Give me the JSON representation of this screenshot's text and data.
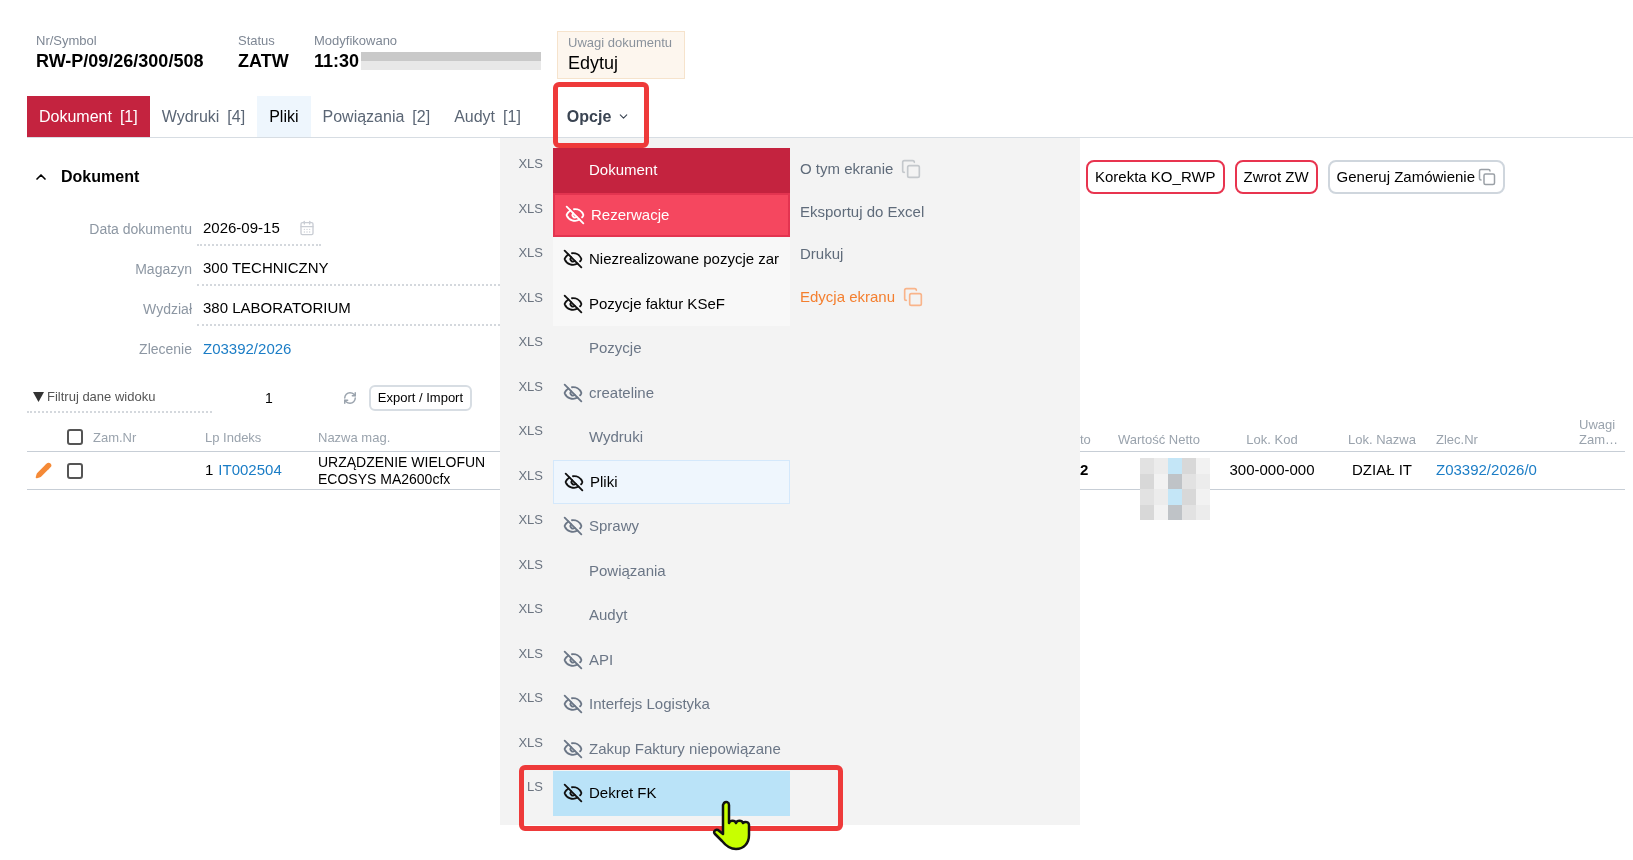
{
  "header": {
    "fields": [
      {
        "label": "Nr/Symbol",
        "value": "RW-P/09/26/300/508"
      },
      {
        "label": "Status",
        "value": "ZATW"
      },
      {
        "label": "Modyfikowano",
        "value": "11:30",
        "redacted": true
      }
    ],
    "notes": {
      "label": "Uwagi dokumentu",
      "value": "Edytuj"
    }
  },
  "tabs": [
    {
      "label": "Dokument",
      "count": "[1]",
      "kind": "tab",
      "selected": true
    },
    {
      "label": "Wydruki",
      "count": "[4]",
      "kind": "tab",
      "selected": false,
      "hovered": false
    },
    {
      "label": "Pliki",
      "kind": "tab",
      "selected": false,
      "hovered": true
    },
    {
      "label": "Powiązania",
      "count": "[2]",
      "kind": "tab",
      "selected": false,
      "hovered": false
    },
    {
      "label": "Audyt",
      "count": "[1]",
      "kind": "tab",
      "selected": false,
      "hovered": false
    },
    {
      "label": "Opcje",
      "kind": "menu",
      "selected": false,
      "hovered": false
    }
  ],
  "section": {
    "title": "Dokument",
    "expanded": true
  },
  "form": [
    {
      "label": "Data dokumentu",
      "value": "2026-09-15",
      "kind": "date"
    },
    {
      "label": "Magazyn",
      "value": "300 TECHNICZNY",
      "kind": "text"
    },
    {
      "label": "Wydział",
      "value": "380 LABORATORIUM",
      "kind": "text"
    },
    {
      "label": "Zlecenie",
      "value": "Z03392/2026",
      "kind": "link"
    }
  ],
  "actions": [
    {
      "label": "Korekta KO_RWP",
      "kind": "danger"
    },
    {
      "label": "Zwrot ZW",
      "kind": "danger"
    },
    {
      "label": "Generuj Zamówienie",
      "kind": "copy"
    }
  ],
  "filter": {
    "label": "Filtruj dane widoku",
    "count": "1",
    "button": "Export / Import"
  },
  "table": {
    "all_checked": false,
    "columns_left": [
      "Zam.Nr",
      "Lp Indeks",
      "Nazwa mag."
    ],
    "columns_right": [
      "to",
      "Wartość Netto",
      "Lok. Kod",
      "Lok. Nazwa",
      "Zlec.Nr",
      "Uwagi Zam…"
    ],
    "rows": [
      {
        "checked": false,
        "lp": "1",
        "index": "IT002504",
        "name": [
          "URZĄDZENIE WIELOFUN",
          "ECOSYS MA2600cfx"
        ],
        "column_to": "2",
        "value_redacted": true,
        "loc_code": "300-000-000",
        "loc_name": "DZIAŁ IT",
        "order": "Z03392/2026/0"
      }
    ]
  },
  "menu": {
    "items": [
      {
        "xls": "XLS",
        "label": "Dokument",
        "kind": "primary",
        "icon": false
      },
      {
        "xls": "XLS",
        "label": "Rezerwacje",
        "kind": "hover",
        "icon": true
      },
      {
        "xls": "XLS",
        "label": "Niezrealizowane pozycje zar",
        "kind": "normal",
        "icon": true
      },
      {
        "xls": "XLS",
        "label": "Pozycje faktur KSeF",
        "kind": "normal",
        "icon": true
      },
      {
        "xls": "XLS",
        "label": "Pozycje",
        "kind": "muted",
        "icon": false
      },
      {
        "xls": "XLS",
        "label": "createline",
        "kind": "muted",
        "icon": true
      },
      {
        "xls": "XLS",
        "label": "Wydruki",
        "kind": "muted",
        "icon": false
      },
      {
        "xls": "XLS",
        "label": "Pliki",
        "kind": "current",
        "icon": true
      },
      {
        "xls": "XLS",
        "label": "Sprawy",
        "kind": "muted",
        "icon": true
      },
      {
        "xls": "XLS",
        "label": "Powiązania",
        "kind": "muted",
        "icon": false
      },
      {
        "xls": "XLS",
        "label": "Audyt",
        "kind": "muted",
        "icon": false
      },
      {
        "xls": "XLS",
        "label": "API",
        "kind": "muted",
        "icon": true
      },
      {
        "xls": "XLS",
        "label": "Interfejs Logistyka",
        "kind": "muted",
        "icon": true
      },
      {
        "xls": "XLS",
        "label": "Zakup Faktury niepowiązane",
        "kind": "muted",
        "icon": true
      },
      {
        "xls": "LS",
        "label": "Dekret FK",
        "kind": "pointed",
        "icon": true
      }
    ],
    "side": [
      {
        "label": "O tym ekranie",
        "kind": "normal",
        "icon": true
      },
      {
        "label": "Eksportuj do Excel",
        "kind": "normal",
        "icon": false
      },
      {
        "label": "Drukuj",
        "kind": "normal",
        "icon": false
      },
      {
        "label": "Edycja ekranu",
        "kind": "accent",
        "icon": true
      }
    ]
  }
}
